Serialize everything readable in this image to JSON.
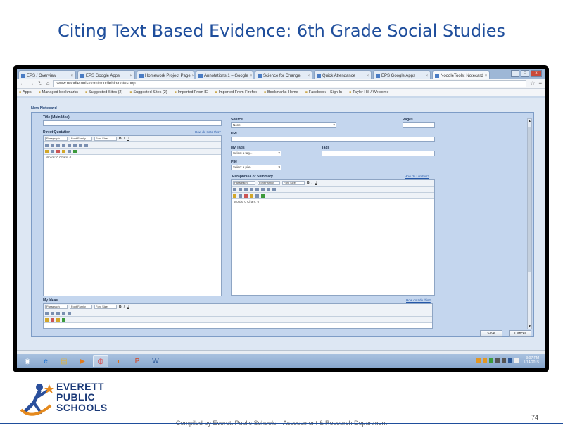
{
  "slide": {
    "title": "Citing Text Based Evidence: 6th Grade Social Studies",
    "footer_credit": "Compiled by Everett Public Schools – Assessment & Research Department",
    "page_number": "74"
  },
  "logo": {
    "lines": [
      "EVERETT",
      "PUBLIC",
      "SCHOOLS"
    ]
  },
  "browser": {
    "tabs": [
      {
        "label": "EPS / Overview"
      },
      {
        "label": "EPS Google Apps"
      },
      {
        "label": "Homework Project Page"
      },
      {
        "label": "Annotations 1 – Google"
      },
      {
        "label": "Science for Change"
      },
      {
        "label": "Quick Attendance"
      },
      {
        "label": "EPS Google Apps"
      },
      {
        "label": "NoodleTools: Notecard"
      }
    ],
    "window_controls": [
      "–",
      "□",
      "x"
    ],
    "url": "www.noodletools.com/noodlebib/notespop",
    "bookmarks": [
      "Apps",
      "Managed bookmarks",
      "Suggested Sites (2)",
      "Suggested Sites (2)",
      "Imported From IE",
      "Imported From Firefox",
      "Bookmarks Home",
      "Facebook – Sign In",
      "Taylor Hill / Welcome"
    ]
  },
  "notecard": {
    "window_title": "New Notecard",
    "title_label": "Title (Main Idea)",
    "direct_quotation_label": "Direct Quotation",
    "how_do_i_cite": "How do I cite this?",
    "source_label": "Source",
    "source_value": "None",
    "pages_label": "Pages",
    "url_label": "URL",
    "my_tags_label": "My Tags",
    "my_tags_value": "Select a tag...",
    "tags_label": "Tags",
    "pile_label": "Pile",
    "pile_value": "Select a pile",
    "paraphrase_label": "Paraphrase or Summary",
    "my_ideas_label": "My Ideas",
    "how_do_i_do_this": "How do I do this?",
    "toolbar": {
      "format": "Paragraph",
      "font_family": "Font Family",
      "font_size": "Font Size",
      "bold": "B",
      "italic": "I",
      "underline": "U"
    },
    "word_count": "Words: 0  Chars: 0",
    "save_button": "Save",
    "cancel_button": "Cancel"
  },
  "taskbar": {
    "apps": [
      "windows-start",
      "internet-explorer",
      "file-explorer",
      "media-player",
      "chrome",
      "firefox",
      "powerpoint",
      "word"
    ],
    "clock_time": "3:07 PM",
    "clock_date": "1/14/2015"
  }
}
